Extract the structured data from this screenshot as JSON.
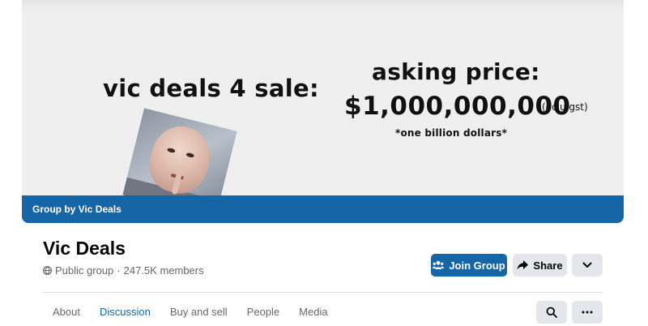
{
  "cover": {
    "meme_left": "vic deals 4 sale:",
    "meme_right_line1": "asking price:",
    "meme_price": "$1,000,000,000",
    "meme_price_note": "(eclu gst)",
    "meme_subtext": "*one billion dollars*",
    "banner_label": "Group by Vic Deals",
    "banner_color": "#1665a4"
  },
  "group": {
    "name": "Vic Deals",
    "privacy": "Public group",
    "separator": "·",
    "members": "247.5K members"
  },
  "actions": {
    "join_label": "Join Group",
    "share_label": "Share"
  },
  "tabs": [
    {
      "label": "About",
      "active": false
    },
    {
      "label": "Discussion",
      "active": true
    },
    {
      "label": "Buy and sell",
      "active": false
    },
    {
      "label": "People",
      "active": false
    },
    {
      "label": "Media",
      "active": false
    }
  ],
  "icons": {
    "globe": "globe-icon",
    "join": "group-icon",
    "share": "share-arrow-icon",
    "more": "chevron-down-icon",
    "search": "search-icon",
    "dots": "more-dots-icon"
  },
  "colors": {
    "accent": "#1665a4",
    "button_grey": "#e4e6eb",
    "text_secondary": "#65676b"
  }
}
